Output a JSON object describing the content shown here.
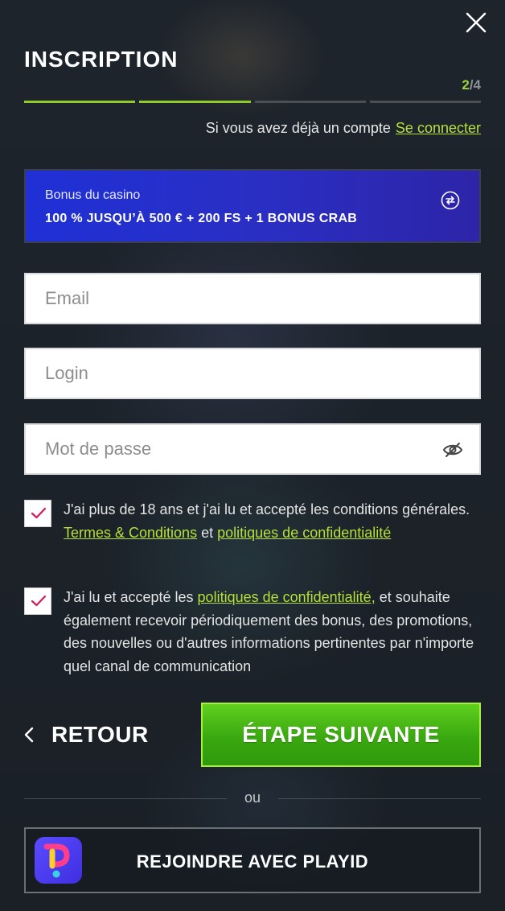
{
  "header": {
    "title": "INSCRIPTION",
    "step_current": "2",
    "step_total": "/4",
    "steps_total": 4,
    "steps_done": 2
  },
  "login_prompt": {
    "text": "Si vous avez déjà un compte",
    "link": "Se connecter"
  },
  "bonus": {
    "label": "Bonus du casino",
    "value": "100 % JUSQU’À 500 € + 200 FS + 1 BONUS CRAB"
  },
  "form": {
    "email_placeholder": "Email",
    "login_placeholder": "Login",
    "password_placeholder": "Mot de passe"
  },
  "consent": {
    "age": {
      "checked": true,
      "text_before": "J'ai plus de 18 ans et j'ai lu et accepté les conditions générales.",
      "link_terms": "Termes & Conditions",
      "text_mid": "et",
      "link_privacy": "politiques de confidentialité"
    },
    "marketing": {
      "checked": true,
      "text_before": "J'ai lu et accepté les",
      "link_privacy": "politiques de confidentialité,",
      "text_after": "et souhaite également recevoir périodiquement des bonus, des promotions, des nouvelles ou d'autres informations pertinentes par n'importe quel canal de communication"
    }
  },
  "actions": {
    "back_label": "RETOUR",
    "next_label": "ÉTAPE SUIVANTE",
    "or_label": "ou",
    "playid_label": "REJOINDRE AVEC PLAYID"
  },
  "colors": {
    "accent_green": "#8fcc2a",
    "link_green": "#b5e03a",
    "bonus_blue": "#1f30d6",
    "next_button": "#3aa810"
  },
  "icons": {
    "close": "close-icon",
    "swap": "swap-icon",
    "eye": "eye-slash-icon",
    "check": "check-icon",
    "back": "chevron-left-icon",
    "playid": "playid-logo"
  }
}
